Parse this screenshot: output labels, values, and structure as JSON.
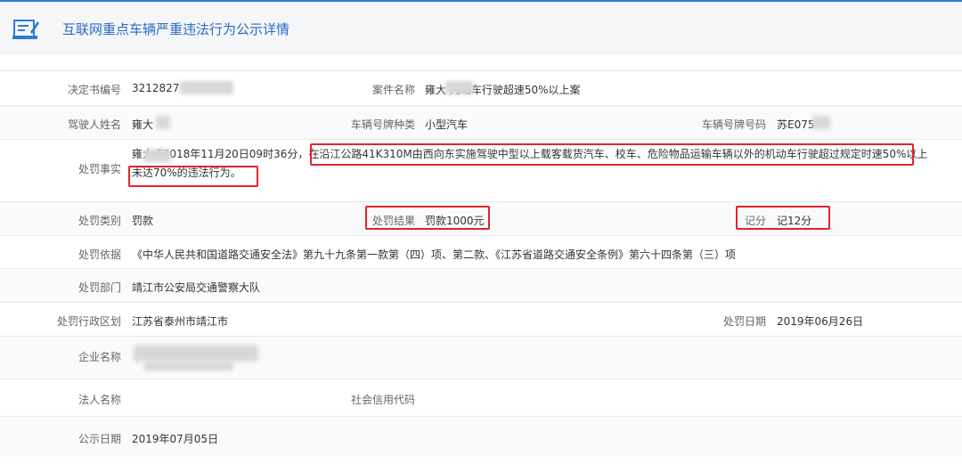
{
  "header": {
    "title": "互联网重点车辆严重违法行为公示详情",
    "icon": "notice-board-icon",
    "accent": "#2f7ad9"
  },
  "fields": {
    "decision_no": {
      "label": "决定书编号",
      "value": "3212827"
    },
    "case_name": {
      "label": "案件名称",
      "value": "雍大    几动车行驶超速50%以上案"
    },
    "driver_name": {
      "label": "驾驶人姓名",
      "value": "雍大"
    },
    "plate_type": {
      "label": "车辆号牌种类",
      "value": "小型汽车"
    },
    "plate_no": {
      "label": "车辆号牌号码",
      "value": "苏E075"
    },
    "facts": {
      "label": "处罚事实",
      "prefix": "雍大    F2018年11月20日09时36分，",
      "highlight1": "在沿江公路41K310M由西向东实施驾驶中型以上载客载货汽车、校车、危险物品运输车辆以外的机动车行驶超过规定时速50%",
      "highlight2": "以上未达70%的违法行为。"
    },
    "penalty_type": {
      "label": "处罚类别",
      "value": "罚款"
    },
    "penalty_result": {
      "label": "处罚结果",
      "value": "罚款1000元"
    },
    "points": {
      "label": "记分",
      "value": "记12分"
    },
    "basis": {
      "label": "处罚依据",
      "value": "《中华人民共和国道路交通安全法》第九十九条第一款第（四）项、第二款、《江苏省道路交通安全条例》第六十四条第（三）项"
    },
    "department": {
      "label": "处罚部门",
      "value": "靖江市公安局交通警察大队"
    },
    "region": {
      "label": "处罚行政区划",
      "value": "江苏省泰州市靖江市"
    },
    "penalty_date": {
      "label": "处罚日期",
      "value": "2019年06月26日"
    },
    "company": {
      "label": "企业名称",
      "value": ""
    },
    "legal_person": {
      "label": "法人名称",
      "value": ""
    },
    "credit_code": {
      "label": "社会信用代码",
      "value": ""
    },
    "publish_date": {
      "label": "公示日期",
      "value": "2019年07月05日"
    }
  },
  "colors": {
    "highlight_box": "#e0252c",
    "title_text": "#2a6ac3"
  }
}
